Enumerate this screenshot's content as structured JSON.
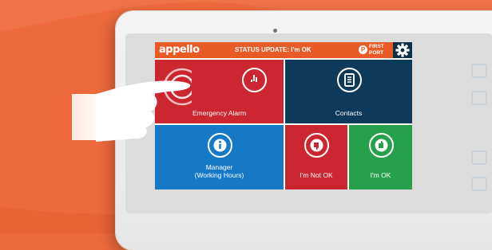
{
  "screen": {
    "logo": "appello",
    "status_text": "STATUS UPDATE: I'm OK",
    "provider": {
      "badge": "P",
      "line1": "FIRST",
      "line2": "PORT"
    },
    "tiles": {
      "emergency": "Emergency Alarm",
      "contacts": "Contacts",
      "manager_line1": "Manager",
      "manager_line2": "(Working Hours)",
      "not_ok": "I'm Not OK",
      "ok": "I'm OK"
    },
    "icons": {
      "settings": "gear-icon",
      "emergency": "alarm-hand-icon",
      "contacts": "address-book-icon",
      "manager": "info-icon",
      "not_ok": "thumbs-down-icon",
      "ok": "thumbs-up-icon"
    }
  },
  "colors": {
    "background": "#ee6a3c",
    "topbar": "#e85a26",
    "emergency": "#cc2730",
    "contacts": "#0d3a5b",
    "manager": "#1679c8",
    "not_ok": "#cc2730",
    "ok": "#26a04d"
  }
}
